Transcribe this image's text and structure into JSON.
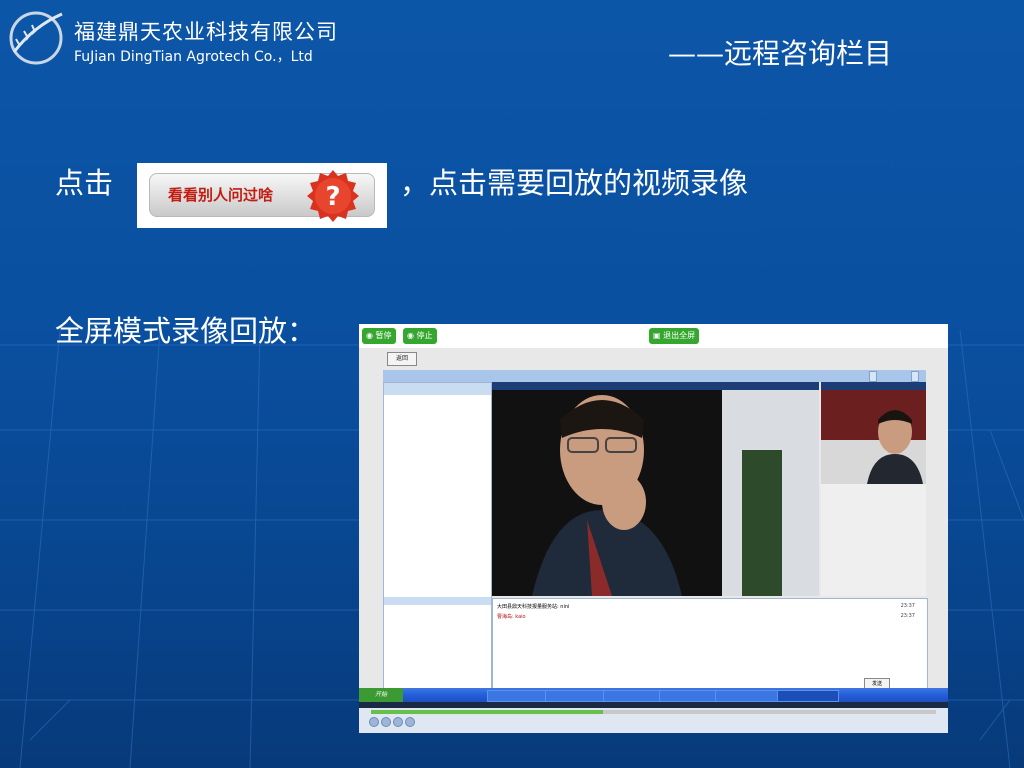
{
  "header": {
    "company_cn": "福建鼎天农业科技有限公司",
    "company_en": "FuJian DingTian Agrotech Co.，Ltd",
    "section_title": "——远程咨询栏目"
  },
  "body": {
    "line1_prefix": "点击",
    "line1_suffix": "，点击需要回放的视频录像",
    "button_image_text": "看看别人问过啥",
    "line2": "全屏模式录像回放："
  },
  "screenshot": {
    "pause_label": "暂停",
    "stop_label": "停止",
    "exit_fullscreen_label": "退出全屏",
    "return_label": "返回",
    "send_label": "发送",
    "chat_messages": [
      {
        "sender": "大田县鼎天科技报量服务站: ",
        "text": "nini",
        "time": "23:37"
      },
      {
        "sender": "曹海岛: ",
        "text": "kaio",
        "time": "23:37"
      }
    ],
    "start_label": "开始",
    "playback_progress_fraction": 0.41
  },
  "colors": {
    "background": "#0a4f9f",
    "accent_green": "#35a72e",
    "question_red": "#d9321e"
  }
}
